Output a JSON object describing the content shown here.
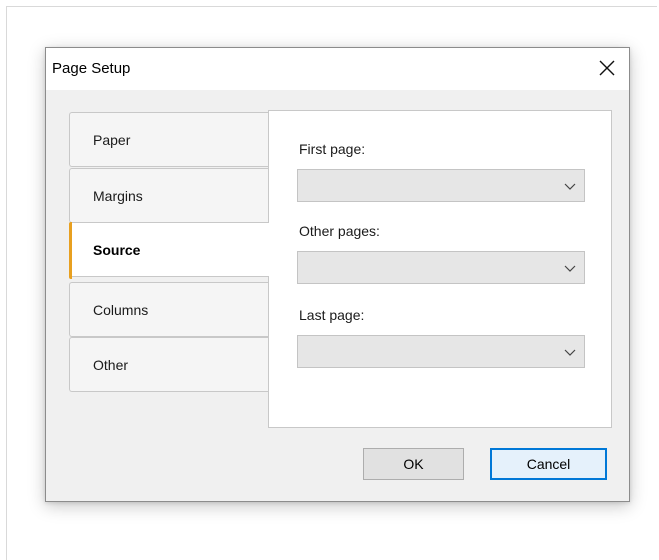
{
  "dialog": {
    "title": "Page Setup",
    "close_icon": "close-icon"
  },
  "tabs": [
    {
      "label": "Paper",
      "active": false
    },
    {
      "label": "Margins",
      "active": false
    },
    {
      "label": "Source",
      "active": true
    },
    {
      "label": "Columns",
      "active": false
    },
    {
      "label": "Other",
      "active": false
    }
  ],
  "source": {
    "first_page_label": "First page:",
    "first_page_value": "",
    "other_pages_label": "Other pages:",
    "other_pages_value": "",
    "last_page_label": "Last page:",
    "last_page_value": ""
  },
  "buttons": {
    "ok_label": "OK",
    "cancel_label": "Cancel"
  },
  "colors": {
    "active_tab_accent": "#e8a020",
    "default_button_border": "#0078d7"
  }
}
